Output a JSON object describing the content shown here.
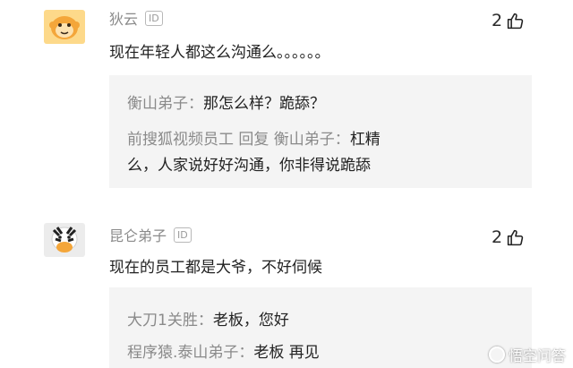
{
  "comments": [
    {
      "username": "狄云",
      "id_badge": "ID",
      "likes": "2",
      "text": "现在年轻人都这么沟通么。。。。。。",
      "avatar": "monkey-avatar",
      "replies": [
        {
          "name": "衡山弟子：",
          "body": "那怎么样？跪舔？"
        },
        {
          "name": "前搜狐视频员工 回复 衡山弟子：",
          "body": "杠精"
        },
        {
          "name": "",
          "body": "么，人家说好好沟通，你非得说跪舔"
        }
      ]
    },
    {
      "username": "昆仑弟子",
      "id_badge": "ID",
      "likes": "2",
      "text": "现在的员工都是大爷，不好伺候",
      "avatar": "zebra-avatar",
      "replies": [
        {
          "name": "大刀1关胜：",
          "body": "老板，您好"
        },
        {
          "name": "程序猿.泰山弟子：",
          "body": "老板 再见"
        }
      ]
    }
  ],
  "watermark": "悟空问答",
  "colors": {
    "username": "#8a8a8a",
    "reply_bg": "#f4f4f4",
    "avatar_orange": "#f4a63a"
  }
}
